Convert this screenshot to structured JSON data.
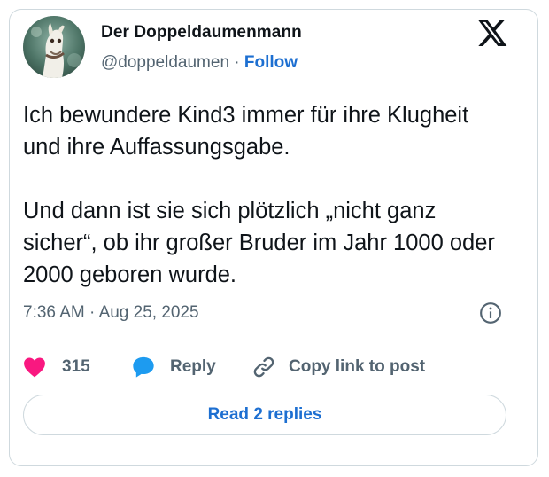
{
  "author": {
    "name": "Der Doppeldaumenmann",
    "handle": "@doppeldaumen",
    "separator": "·",
    "follow_label": "Follow",
    "avatar_icon": "horse-avatar"
  },
  "brand": {
    "icon": "x-logo-icon"
  },
  "tweet": {
    "paragraph_1": "Ich bewundere Kind3 immer für ihre Klugheit und ihre Auffassungsgabe.",
    "paragraph_2": "Und dann ist sie sich plötzlich „nicht ganz sicher“, ob ihr großer Bruder im Jahr 1000 oder 2000 geboren wurde."
  },
  "meta": {
    "time": "7:36 AM",
    "separator": "·",
    "date": "Aug 25, 2025",
    "info_icon": "info-icon"
  },
  "actions": {
    "like_count": "315",
    "reply_label": "Reply",
    "copy_label": "Copy link to post"
  },
  "footer": {
    "read_replies_label": "Read 2 replies"
  },
  "colors": {
    "accent": "#1d6fd1",
    "heart": "#f91880",
    "reply_bubble": "#1d9bf0",
    "muted_text": "#536471",
    "border": "#cfd9de"
  }
}
